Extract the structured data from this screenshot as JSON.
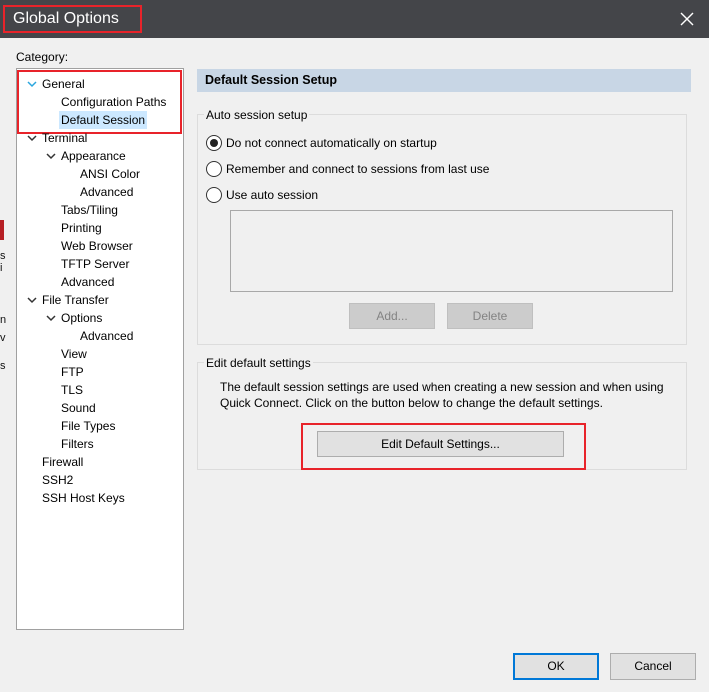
{
  "window": {
    "title": "Global Options",
    "close_icon": "close-icon"
  },
  "left_edge_glyphs": [
    "s",
    "i",
    "n",
    "v",
    "s"
  ],
  "category": {
    "label": "Category:",
    "tree": [
      {
        "label": "General",
        "level": 0,
        "expanded": true,
        "arrow_color": "#2aa6de"
      },
      {
        "label": "Configuration Paths",
        "level": 2
      },
      {
        "label": "Default Session",
        "level": 2,
        "selected": true
      },
      {
        "label": "Terminal",
        "level": 0,
        "expanded": true
      },
      {
        "label": "Appearance",
        "level": 1,
        "expanded": true
      },
      {
        "label": "ANSI Color",
        "level": 3
      },
      {
        "label": "Advanced",
        "level": 3
      },
      {
        "label": "Tabs/Tiling",
        "level": 2
      },
      {
        "label": "Printing",
        "level": 2
      },
      {
        "label": "Web Browser",
        "level": 2
      },
      {
        "label": "TFTP Server",
        "level": 2
      },
      {
        "label": "Advanced",
        "level": 2
      },
      {
        "label": "File Transfer",
        "level": 0,
        "expanded": true
      },
      {
        "label": "Options",
        "level": 1,
        "expanded": true
      },
      {
        "label": "Advanced",
        "level": 3
      },
      {
        "label": "View",
        "level": 2
      },
      {
        "label": "FTP",
        "level": 2
      },
      {
        "label": "TLS",
        "level": 2
      },
      {
        "label": "Sound",
        "level": 2
      },
      {
        "label": "File Types",
        "level": 2
      },
      {
        "label": "Filters",
        "level": 2
      },
      {
        "label": "Firewall",
        "level": 0
      },
      {
        "label": "SSH2",
        "level": 0
      },
      {
        "label": "SSH Host Keys",
        "level": 0
      }
    ]
  },
  "panel": {
    "header": "Default Session Setup",
    "auto_session": {
      "label": "Auto session setup",
      "options": [
        {
          "label": "Do not connect automatically on startup",
          "checked": true
        },
        {
          "label": "Remember and connect to sessions from last use",
          "checked": false
        },
        {
          "label": "Use auto session",
          "checked": false
        }
      ],
      "add_button": "Add...",
      "delete_button": "Delete"
    },
    "edit_defaults": {
      "label": "Edit default settings",
      "description": "The default session settings are used when creating a new session and when using Quick Connect.  Click on the button below to change the default settings.",
      "button": "Edit Default Settings..."
    }
  },
  "footer": {
    "ok_button": "OK",
    "cancel_button": "Cancel"
  },
  "colors": {
    "titlebar": "#444549",
    "highlight_annotation": "#e8232a",
    "selection": "#cce8ff",
    "panel_header": "#c8d6e5",
    "default_button_border": "#0078d7"
  }
}
